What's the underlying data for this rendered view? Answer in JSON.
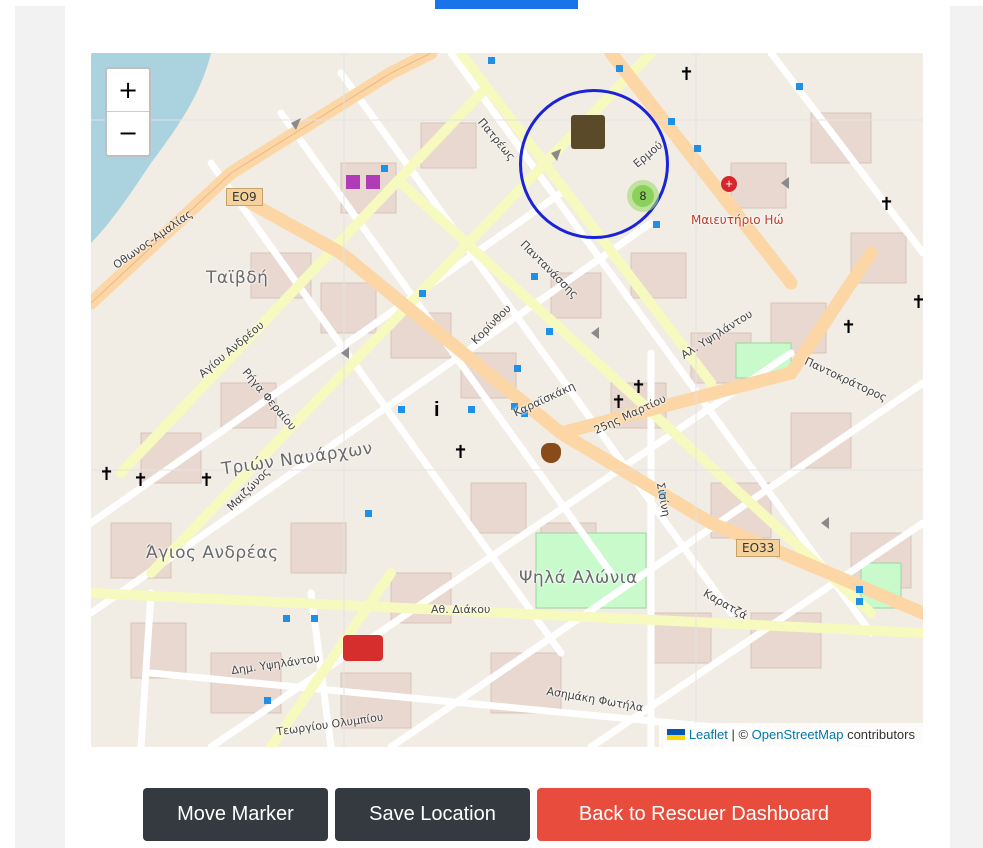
{
  "map": {
    "zoom_in_label": "+",
    "zoom_out_label": "−",
    "attribution": {
      "leaflet": "Leaflet",
      "separator": " | © ",
      "osm": "OpenStreetMap",
      "suffix": " contributors"
    },
    "cluster_count": "8",
    "road_shields": [
      "EO9",
      "EO33"
    ],
    "districts": [
      "Ψηλά Αλώνια",
      "Ταϊβδή",
      "Τριών Ναυάρχων",
      "Άγιος Ανδρέας"
    ],
    "streets": [
      "Οθωνος-Αμαλίας",
      "Αγίου Ανδρέου",
      "Ερμού",
      "Κορίνθου",
      "Καρατζά",
      "25ης Μαρτίου",
      "Πατρέως",
      "Μαιζώνος",
      "Παντανάσσης",
      "Ρήγα Φεραίου",
      "Αθ. Διάκου",
      "Ασημάκη Φωτήλα",
      "Τεωργίου Ολυμπίου",
      "Δημ. Υψηλάντου",
      "Καραϊσκάκη",
      "Αλ. Υψηλάντου",
      "Παντοκράτορος",
      "Σισίνη",
      "Μαιευτήριο Ηώ"
    ],
    "colors": {
      "radius_circle": "#1a24d6",
      "cluster": "#8bd05a"
    }
  },
  "actions": {
    "move_marker": "Move Marker",
    "save_location": "Save Location",
    "back": "Back to Rescuer Dashboard"
  }
}
